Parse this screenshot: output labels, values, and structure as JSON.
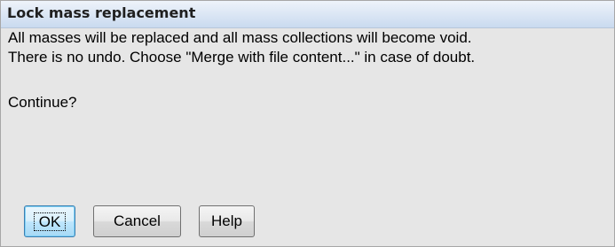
{
  "dialog": {
    "title": "Lock mass replacement",
    "message_line1": "All masses will be replaced and all mass collections will become void.",
    "message_line2": "There is no undo. Choose \"Merge with file content...\" in case of doubt.",
    "prompt": "Continue?"
  },
  "buttons": {
    "ok_label": "OK",
    "cancel_label": "Cancel",
    "help_label": "Help"
  },
  "colors": {
    "dialog_background": "#e6e6e6",
    "title_bar_top": "#eef3fa",
    "title_bar_bottom": "#c9daef",
    "default_button_border": "#3c7fb1"
  }
}
